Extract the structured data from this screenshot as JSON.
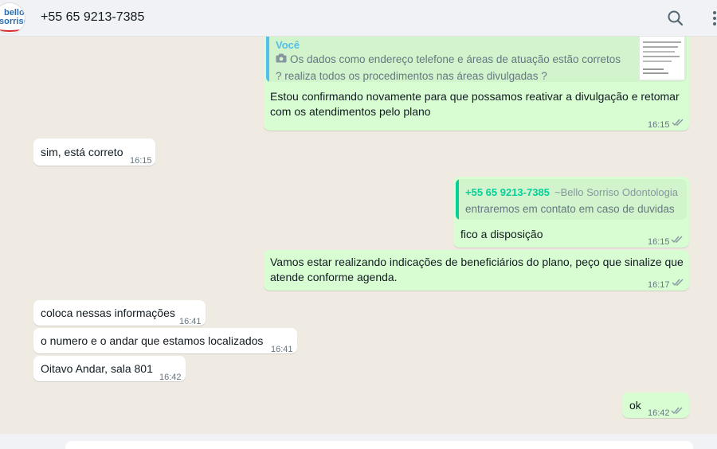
{
  "header": {
    "avatar_line1": "bello",
    "avatar_line2": "sorriso",
    "contact_name": "+55 65 9213-7385"
  },
  "messages": [
    {
      "direction": "outgoing",
      "quote": {
        "author": "Você",
        "text": "Os dados como endereço telefone e áreas de atuação estão corretos ? realiza todos os procedimentos nas áreas divulgadas ?",
        "has_image_icon": true
      },
      "text": "Estou confirmando novamente para que possamos reativar a divulgação e retomar com os atendimentos pelo plano",
      "time": "16:15",
      "status": "read"
    },
    {
      "direction": "incoming",
      "text": "sim, está correto",
      "time": "16:15"
    },
    {
      "direction": "outgoing",
      "quote": {
        "author": "+55 65 9213-7385",
        "author_suffix": "~Bello Sorriso Odontologia",
        "text": "entraremos em contato em caso de duvidas"
      },
      "text": "fico a disposição",
      "time": "16:15",
      "status": "read"
    },
    {
      "direction": "outgoing",
      "text": "Vamos estar realizando indicações de beneficiários do plano, peço que sinalize que atende conforme agenda.",
      "time": "16:17",
      "status": "read"
    },
    {
      "direction": "incoming",
      "text": "coloca nessas informações",
      "time": "16:41"
    },
    {
      "direction": "incoming",
      "text": "o numero e o andar que estamos localizados",
      "time": "16:41"
    },
    {
      "direction": "incoming",
      "text": "Oitavo Andar, sala 801",
      "time": "16:42"
    },
    {
      "direction": "outgoing",
      "text": "ok",
      "time": "16:42",
      "status": "read"
    }
  ],
  "colors": {
    "outgoing_bubble": "#d9fdd3",
    "incoming_bubble": "#ffffff",
    "chat_background": "#efeae2",
    "read_ticks": "#8696a0",
    "quote_bar_self": "#53bdeb",
    "quote_bar_contact": "#06cf9c"
  },
  "icons": {
    "search": "search-icon",
    "menu": "menu-dots-icon",
    "camera": "camera-icon",
    "ticks": "double-check-icon"
  }
}
